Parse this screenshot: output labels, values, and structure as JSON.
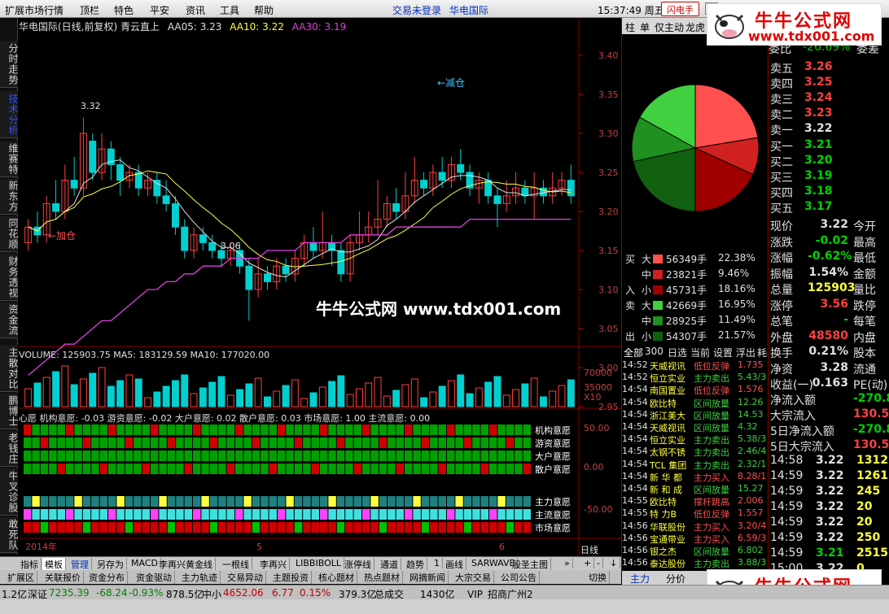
{
  "menu": {
    "items": [
      "扩展市场行情",
      "顶栏",
      "特色",
      "平安",
      "资讯",
      "工具",
      "帮助"
    ],
    "center": [
      "交易未登录",
      "华电国际"
    ],
    "time": "15:37:49 周五",
    "flash_btn": "闪电手"
  },
  "left_tabs": [
    "分时走势",
    "技术分析",
    "维赛特",
    "新东方",
    "同花顺",
    "财务透视",
    "资金流",
    "主散对比",
    "鹏博士",
    "老钱庄",
    "牛叉诊股",
    "敢死队"
  ],
  "chart": {
    "title": "华电国际(日线,前复权) 青云直上",
    "ma_labels": [
      {
        "label": "AA05: 3.23",
        "color": "#e0e0e0"
      },
      {
        "label": "AA10: 3.22",
        "color": "#ffff40"
      },
      {
        "label": "AA30: 3.19",
        "color": "#e040e0"
      }
    ],
    "price_ticks": [
      "3.40",
      "3.35",
      "3.30",
      "3.25",
      "3.20",
      "3.15",
      "3.10",
      "3.05",
      "3.00",
      "2.95"
    ],
    "annotations": {
      "high": "3.32",
      "low": "3.06",
      "buy": "←加仓",
      "sell": "←减仓"
    },
    "volume_title": "VOLUME: 125903.75  MA5: 183129.59  MA10: 177020.00",
    "volume_ticks": [
      "70000",
      "35000",
      "X10"
    ],
    "will_title": "心愿  机构意愿: -0.03  游资意愿: -0.02  大户意愿: 0.02  散户意愿: 0.03  市场意愿: 1.00  主流意愿: 0.00",
    "will_ticks": [
      "50.00",
      "0.00",
      "-50.00"
    ],
    "will_labels": [
      "机构意愿",
      "游资意愿",
      "大户意愿",
      "散户意愿",
      "主力意愿",
      "主流意愿",
      "市场意愿"
    ],
    "date_labels": [
      "2014年",
      "5",
      "6"
    ],
    "period": "日线"
  },
  "bottom_tabs": [
    "指标",
    "模板",
    "管理",
    "另存为",
    "MACD",
    "李再兴黄金线",
    "一根线",
    "李再兴",
    "LIBBIBOLL",
    "涨停线",
    "通道",
    "趋势",
    "1",
    "画线",
    "SARWAVE",
    "股圣主图"
  ],
  "bottom_tabs2": [
    "扩展区",
    "关联报价",
    "资金分布",
    "资金驱动",
    "主力轨迹",
    "交易异动",
    "主题投资",
    "核心题材",
    "热点题材",
    "网摘新闻",
    "大宗交易",
    "公司公告"
  ],
  "right_tabs": [
    "柱",
    "单",
    "仅主动",
    "龙虎"
  ],
  "pie_legend": [
    {
      "side": "买",
      "size": "大",
      "val": "56349手",
      "pct": "22.38%",
      "color": "#ff5050"
    },
    {
      "side": "",
      "size": "中",
      "val": "23821手",
      "pct": "9.46%",
      "color": "#d02020"
    },
    {
      "side": "入",
      "size": "小",
      "val": "45731手",
      "pct": "18.16%",
      "color": "#a00000"
    },
    {
      "side": "卖",
      "size": "大",
      "val": "42669手",
      "pct": "16.95%",
      "color": "#40d040"
    },
    {
      "side": "",
      "size": "中",
      "val": "28925手",
      "pct": "11.49%",
      "color": "#209020"
    },
    {
      "side": "出",
      "size": "小",
      "val": "54307手",
      "pct": "21.57%",
      "color": "#106010"
    }
  ],
  "ticker_tabs": [
    "全部",
    "300",
    "日选",
    "当前",
    "设置",
    "浮出",
    "耗"
  ],
  "ticker": [
    {
      "t": "14:52",
      "n": "天威视讯",
      "s": "低位反弹",
      "v": "1.735"
    },
    {
      "t": "14:52",
      "n": "恒立实业",
      "s": "主力卖出",
      "v": "5.43/3"
    },
    {
      "t": "14:54",
      "n": "南国置业",
      "s": "低位反弹",
      "v": "1.576"
    },
    {
      "t": "14:54",
      "n": "欧比特",
      "s": "区间放量",
      "v": "12.26"
    },
    {
      "t": "14:54",
      "n": "浙江美大",
      "s": "区间放量",
      "v": "14.53"
    },
    {
      "t": "14:54",
      "n": "天威视讯",
      "s": "区间放量",
      "v": "4.32"
    },
    {
      "t": "14:54",
      "n": "恒立实业",
      "s": "主力卖出",
      "v": "5.38/3"
    },
    {
      "t": "14:54",
      "n": "太钢不锈",
      "s": "主力卖出",
      "v": "2.46/4"
    },
    {
      "t": "14:54",
      "n": "TCL 集团",
      "s": "主力卖出",
      "v": "2.32/1"
    },
    {
      "t": "14:54",
      "n": "新 华 都",
      "s": "主力买入",
      "v": "8.28/1"
    },
    {
      "t": "14:54",
      "n": "新 和 成",
      "s": "区间放量",
      "v": "15.27"
    },
    {
      "t": "14:55",
      "n": "欧比特",
      "s": "撑杆跳高",
      "v": "2.006"
    },
    {
      "t": "14:55",
      "n": "特 力B",
      "s": "低位反弹",
      "v": "1.557"
    },
    {
      "t": "14:56",
      "n": "华联股份",
      "s": "主力买入",
      "v": "3.20/4"
    },
    {
      "t": "14:56",
      "n": "宝通带业",
      "s": "主力买入",
      "v": "6.59/3"
    },
    {
      "t": "14:56",
      "n": "银之杰",
      "s": "区间放量",
      "v": "6.802"
    },
    {
      "t": "14:56",
      "n": "泰达股份",
      "s": "主力卖出",
      "v": "3.88/3"
    }
  ],
  "right_bottom_tabs": [
    "主力",
    "分价"
  ],
  "quote": {
    "top": {
      "label": "委比",
      "pct": "-26.69%",
      "tail": "委差"
    },
    "sells": [
      [
        "卖五",
        "3.26"
      ],
      [
        "卖四",
        "3.25"
      ],
      [
        "卖三",
        "3.24"
      ],
      [
        "卖二",
        "3.23"
      ],
      [
        "卖一",
        "3.22"
      ]
    ],
    "buys": [
      [
        "买一",
        "3.21"
      ],
      [
        "买二",
        "3.20"
      ],
      [
        "买三",
        "3.19"
      ],
      [
        "买四",
        "3.18"
      ],
      [
        "买五",
        "3.17"
      ]
    ],
    "stats": [
      [
        "现价",
        "3.22",
        "今开"
      ],
      [
        "涨跌",
        "-0.02",
        "最高"
      ],
      [
        "涨幅",
        "-0.62%",
        "最低"
      ],
      [
        "振幅",
        "1.54%",
        "金额"
      ],
      [
        "总量",
        "125903",
        "量比"
      ],
      [
        "涨停",
        "3.56",
        "跌停"
      ],
      [
        "总笔",
        "-",
        "每笔"
      ],
      [
        "外盘",
        "48580",
        "内盘"
      ],
      [
        "换手",
        "0.21%",
        "股本"
      ],
      [
        "净资",
        "3.28",
        "流通"
      ],
      [
        "收益(一)",
        "0.163",
        "PE(动)"
      ]
    ],
    "flows": [
      [
        "净流入额",
        "-270.8"
      ],
      [
        "大宗流入",
        "130.5"
      ],
      [
        "5日净流入额",
        "-270.8"
      ],
      [
        "5日大宗流入",
        "130.5"
      ]
    ],
    "trades": [
      [
        "14:58",
        "3.22",
        "1312"
      ],
      [
        "14:59",
        "3.22",
        "1261"
      ],
      [
        "14:59",
        "3.22",
        "245"
      ],
      [
        "14:59",
        "3.22",
        "20"
      ],
      [
        "14:59",
        "3.22",
        "20"
      ],
      [
        "14:59",
        "3.22",
        "250"
      ],
      [
        "14:59",
        "3.21",
        "2515"
      ],
      [
        "15:00",
        "3.22",
        "0"
      ]
    ]
  },
  "status": {
    "items": [
      "1.2亿",
      "深证",
      "7235.39",
      "-68.24",
      "-0.93%",
      "878.5亿",
      "中小",
      "4652.06",
      "6.77",
      "0.15%",
      "379.3亿",
      "总成交",
      "1430亿",
      "VIP_招商广州2"
    ]
  },
  "watermark": "牛牛公式网 www.tdx001.com",
  "logo": {
    "t1": "牛牛公式网",
    "t2": "www.tdx001.com"
  },
  "colors": {
    "up": "#ff4040",
    "down": "#00d0d0",
    "ma5": "#e0e0e0",
    "ma10": "#ffff40",
    "ma30": "#e040e0"
  }
}
